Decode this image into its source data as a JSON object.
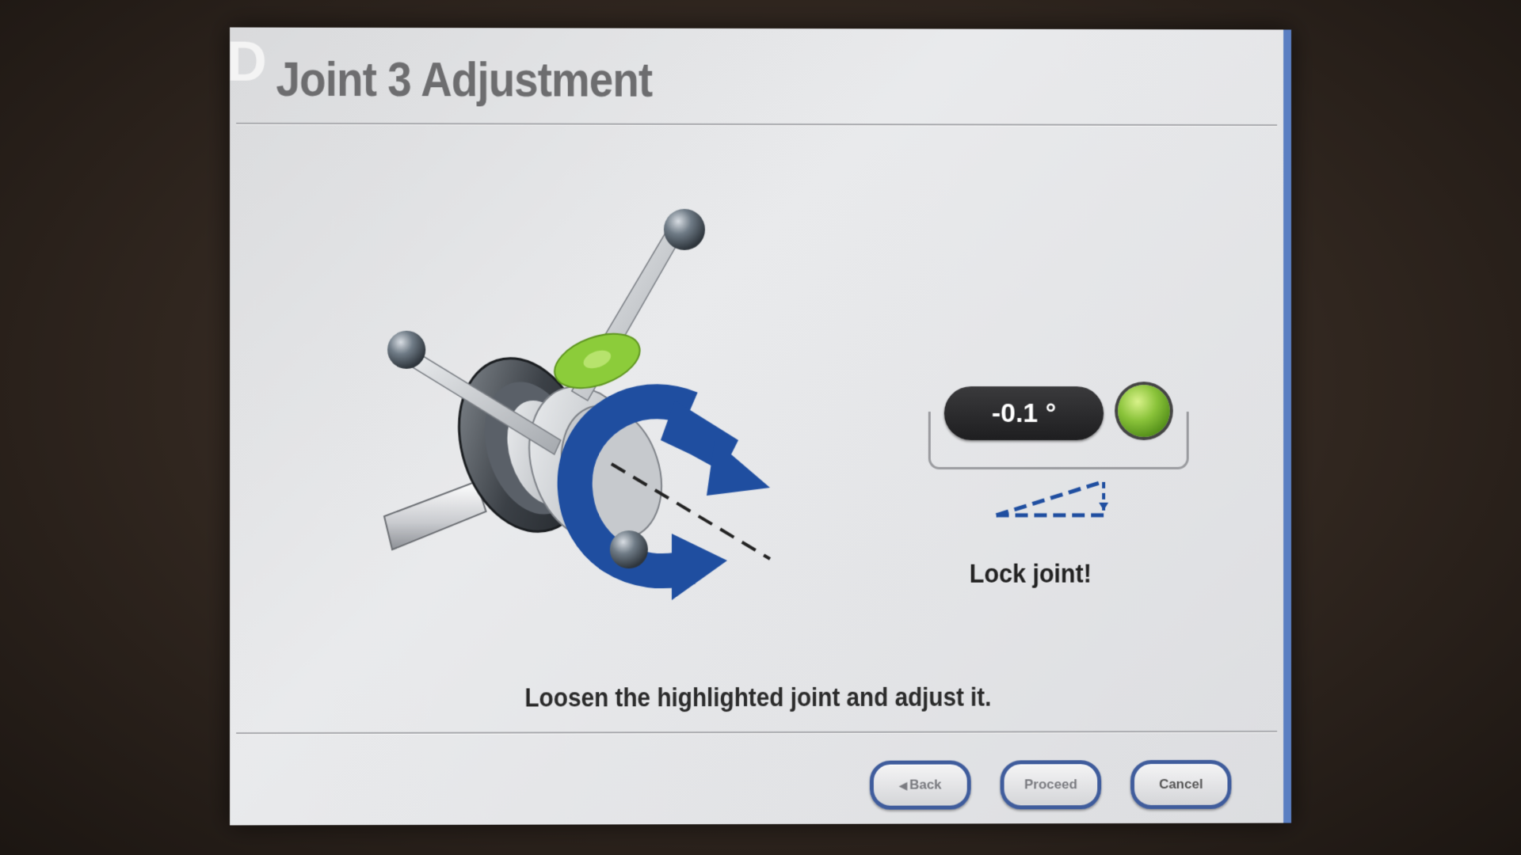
{
  "screen": {
    "corner_letter": "D",
    "title": "Joint 3 Adjustment"
  },
  "readout": {
    "value": "-0.1 °",
    "status": "Lock joint!",
    "status_color": "#7fbf2f"
  },
  "instruction": "Loosen the highlighted joint and adjust it.",
  "buttons": {
    "back": "Back",
    "back_icon": "left-triangle-icon",
    "proceed": "Proceed",
    "cancel": "Cancel"
  },
  "colors": {
    "accent_blue": "#1f4ea0",
    "highlight_green": "#8ccc3a",
    "button_border": "#3f5c9c"
  }
}
